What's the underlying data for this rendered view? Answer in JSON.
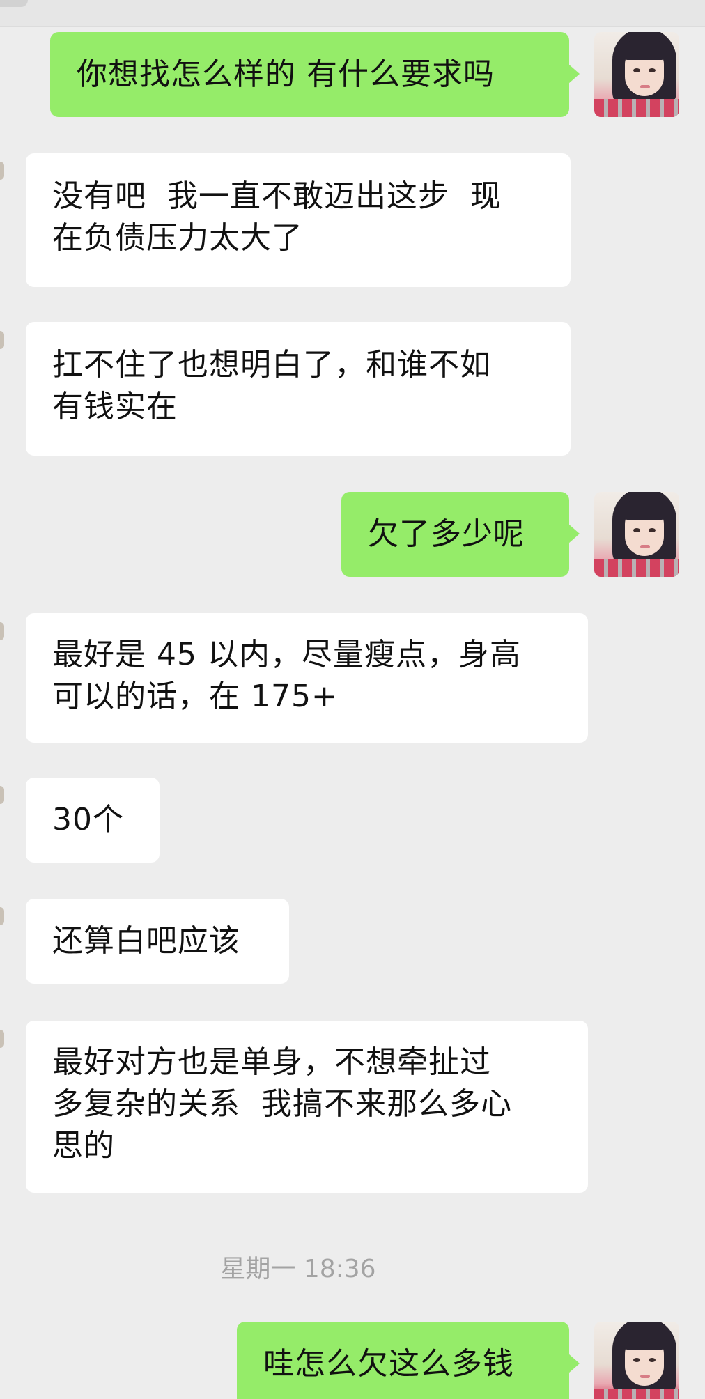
{
  "messages": [
    {
      "side": "me",
      "text": "你想找怎么样的 有什么要求吗"
    },
    {
      "side": "other",
      "lines": [
        "没有吧  我一直不敢迈出这步  现",
        "在负债压力太大了"
      ]
    },
    {
      "side": "other",
      "lines": [
        "扛不住了也想明白了，和谁不如",
        "有钱实在"
      ]
    },
    {
      "side": "me",
      "text": "欠了多少呢"
    },
    {
      "side": "other",
      "lines": [
        "最好是 45 以内，尽量瘦点，身高",
        "可以的话，在 175+"
      ]
    },
    {
      "side": "other",
      "text": "30个"
    },
    {
      "side": "other",
      "text": "还算白吧应该"
    },
    {
      "side": "other",
      "lines": [
        "最好对方也是单身，不想牵扯过",
        "多复杂的关系  我搞不来那么多心",
        "思的"
      ]
    },
    {
      "side": "me",
      "text": "哇怎么欠这么多钱"
    }
  ],
  "timestamp": "星期一 18:36",
  "colors": {
    "me_bubble": "#95ec69",
    "other_bubble": "#ffffff",
    "background": "#ededed"
  }
}
